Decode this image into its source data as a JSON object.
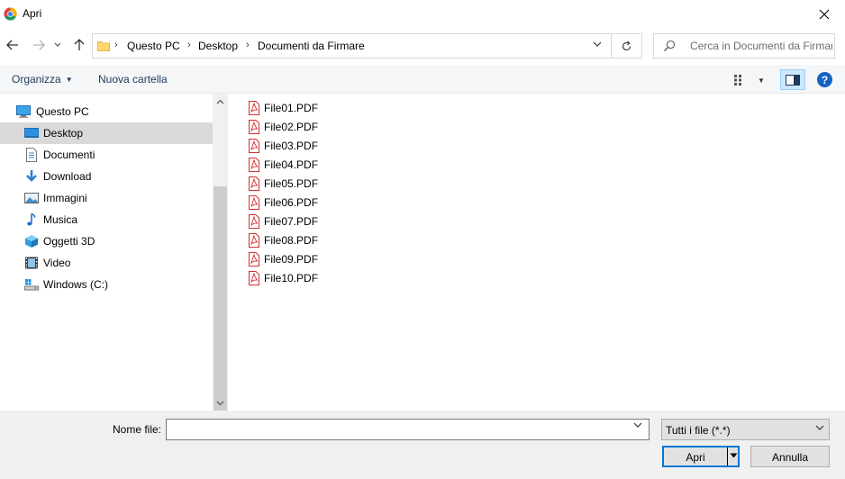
{
  "window": {
    "title": "Apri",
    "app_icon": "chrome-icon",
    "close_icon": "close-icon"
  },
  "nav": {
    "back_icon": "arrow-left-icon",
    "forward_icon": "arrow-right-icon",
    "recent_icon": "chevron-down-icon",
    "up_icon": "arrow-up-icon"
  },
  "address": {
    "crumbs": [
      "Questo PC",
      "Desktop",
      "Documenti da Firmare"
    ],
    "refresh_icon": "refresh-icon"
  },
  "search": {
    "placeholder": "Cerca in Documenti da Firmare"
  },
  "toolbar": {
    "organize_label": "Organizza",
    "new_folder_label": "Nuova cartella",
    "help_label": "?"
  },
  "sidebar": {
    "items": [
      {
        "label": "Questo PC",
        "icon": "computer-icon"
      },
      {
        "label": "Desktop",
        "icon": "desktop-icon",
        "selected": true
      },
      {
        "label": "Documenti",
        "icon": "documents-icon"
      },
      {
        "label": "Download",
        "icon": "download-icon"
      },
      {
        "label": "Immagini",
        "icon": "pictures-icon"
      },
      {
        "label": "Musica",
        "icon": "music-icon"
      },
      {
        "label": "Oggetti 3D",
        "icon": "3d-objects-icon"
      },
      {
        "label": "Video",
        "icon": "video-icon"
      },
      {
        "label": "Windows (C:)",
        "icon": "drive-icon"
      }
    ]
  },
  "files": [
    "File01.PDF",
    "File02.PDF",
    "File03.PDF",
    "File04.PDF",
    "File05.PDF",
    "File06.PDF",
    "File07.PDF",
    "File08.PDF",
    "File09.PDF",
    "File10.PDF"
  ],
  "footer": {
    "filename_label": "Nome file:",
    "filename_value": "",
    "filetype_value": "Tutti i file (*.*)",
    "open_label": "Apri",
    "cancel_label": "Annulla"
  }
}
